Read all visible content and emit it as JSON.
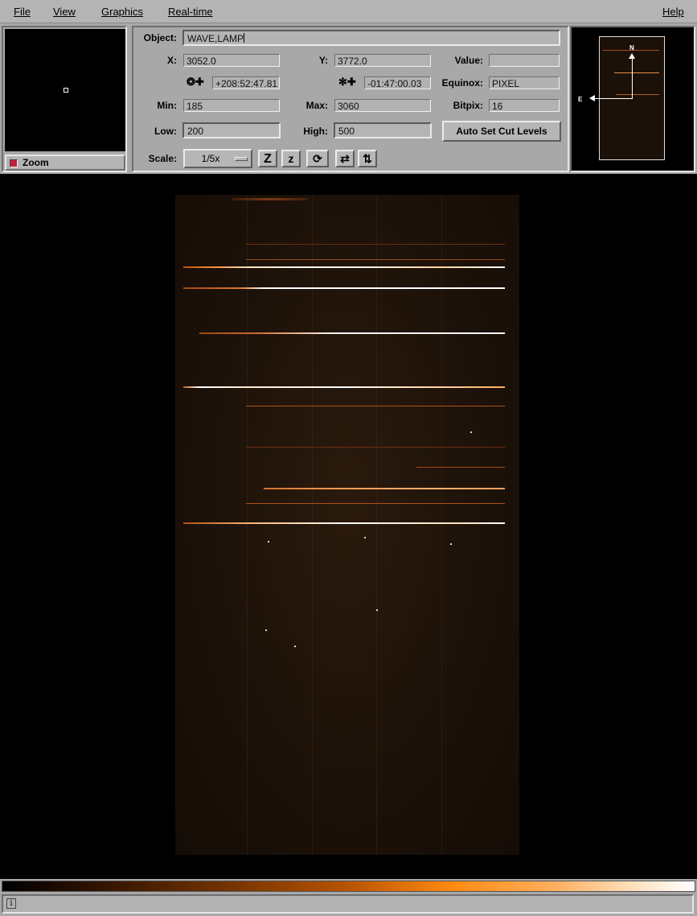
{
  "menu": {
    "file": "File",
    "view": "View",
    "graphics": "Graphics",
    "realtime": "Real-time",
    "help": "Help"
  },
  "zoom": {
    "label": "Zoom"
  },
  "info": {
    "object_label": "Object:",
    "object_value": "WAVE,LAMP",
    "x_label": "X:",
    "x_value": "3052.0",
    "y_label": "Y:",
    "y_value": "3772.0",
    "value_label": "Value:",
    "value_value": "",
    "ra_value": "+208:52:47.81",
    "dec_value": "-01:47:00.03",
    "equinox_label": "Equinox:",
    "equinox_value": "PIXEL",
    "min_label": "Min:",
    "min_value": "185",
    "max_label": "Max:",
    "max_value": "3060",
    "bitpix_label": "Bitpix:",
    "bitpix_value": "16",
    "low_label": "Low:",
    "low_value": "200",
    "high_label": "High:",
    "high_value": "500",
    "autocut_label": "Auto Set Cut Levels",
    "scale_label": "Scale:",
    "scale_value": "1/5x"
  },
  "toolbar_icons": [
    "zoom-in-icon",
    "zoom-out-icon",
    "rotate-icon",
    "flip-x-icon",
    "flip-y-icon"
  ],
  "toolbar_glyphs": {
    "zoom_in": "Z",
    "zoom_out": "z",
    "rotate": "⟳",
    "flip_x": "⇄",
    "flip_y": "⇅"
  },
  "compass": {
    "north": "N",
    "east": "E"
  },
  "status": {
    "info_glyph": "i"
  },
  "colors": {
    "accent": "#ff8a10",
    "background": "#a8a8a8",
    "image_bg": "#000000"
  }
}
